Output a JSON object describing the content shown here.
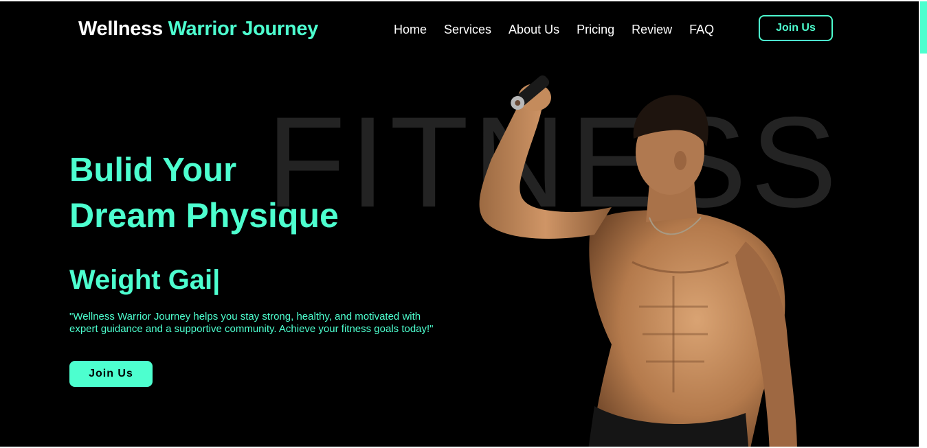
{
  "header": {
    "logo_main": "Wellness",
    "logo_accent": "Warrior Journey",
    "nav": [
      "Home",
      "Services",
      "About Us",
      "Pricing",
      "Review",
      "FAQ"
    ],
    "join_label": "Join Us"
  },
  "hero": {
    "bg_word": "FITNESS",
    "headline_line1": "Bulid Your",
    "headline_line2": "Dream Physique",
    "typed_text": "Weight Gai|",
    "description": "\"Wellness Warrior Journey helps you stay strong, healthy, and motivated with expert guidance and a supportive community. Achieve your fitness goals today!\"",
    "cta_label": "Join Us",
    "image_subject": "shirtless-athlete-flexing-with-dumbbell"
  },
  "colors": {
    "background": "#000000",
    "accent": "#4dffcf",
    "text_light": "#ffffff"
  }
}
